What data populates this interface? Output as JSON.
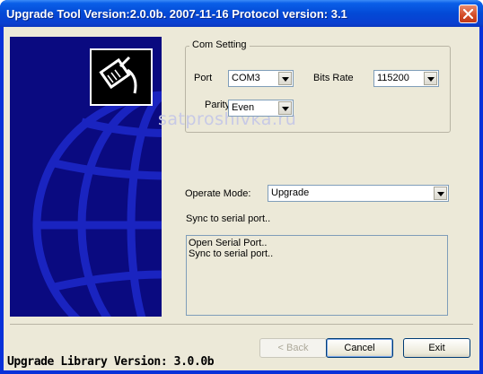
{
  "window": {
    "title": "Upgrade Tool Version:2.0.0b. 2007-11-16 Protocol version: 3.1"
  },
  "watermark": "satproshivka.ru",
  "com_setting": {
    "legend": "Com Setting",
    "port_label": "Port",
    "port_value": "COM3",
    "bits_rate_label": "Bits Rate",
    "bits_rate_value": "115200",
    "parity_label": "Parity",
    "parity_value": "Even"
  },
  "operate_mode": {
    "label": "Operate Mode:",
    "value": "Upgrade"
  },
  "status": "Sync to serial port..",
  "log": [
    "Open Serial Port..",
    "Sync to serial port.."
  ],
  "footer": "Upgrade Library Version: 3.0.0b",
  "buttons": {
    "back": "< Back",
    "cancel": "Cancel",
    "exit": "Exit"
  },
  "icons": {
    "close": "close-icon",
    "logo": "network-cable-icon",
    "dropdown": "chevron-down-icon"
  }
}
